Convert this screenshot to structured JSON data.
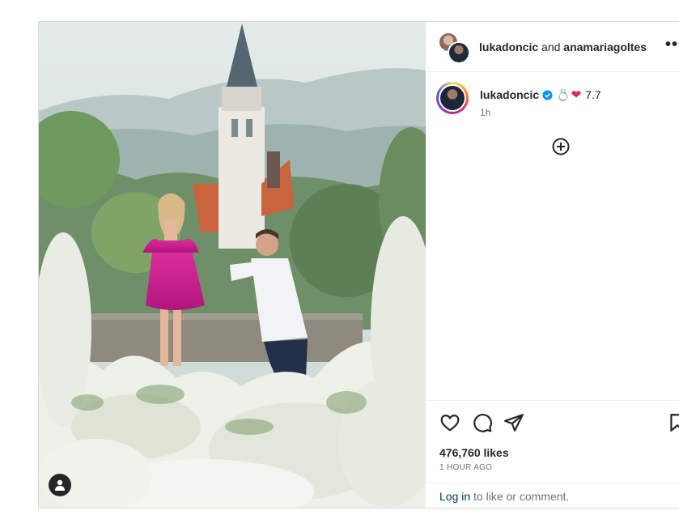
{
  "post": {
    "header": {
      "author1": "lukadoncic",
      "conjunction": "and",
      "author2": "anamariagoltes",
      "more_symbol": "•••"
    },
    "caption": {
      "username": "lukadoncic",
      "emojis": [
        "💍",
        "❤"
      ],
      "text": "7.7",
      "time": "1h"
    },
    "likes": "476,760 likes",
    "time_ago": "1 HOUR AGO",
    "login": {
      "link": "Log in",
      "rest": "to like or comment."
    }
  },
  "colors": {
    "verified": "#0095f6",
    "heart": "#e0245e",
    "link": "#00376b",
    "muted": "#737373"
  },
  "icons": [
    "like-icon",
    "comment-icon",
    "share-icon",
    "save-icon",
    "add-icon",
    "tag-user-icon",
    "verified-icon",
    "more-icon"
  ]
}
